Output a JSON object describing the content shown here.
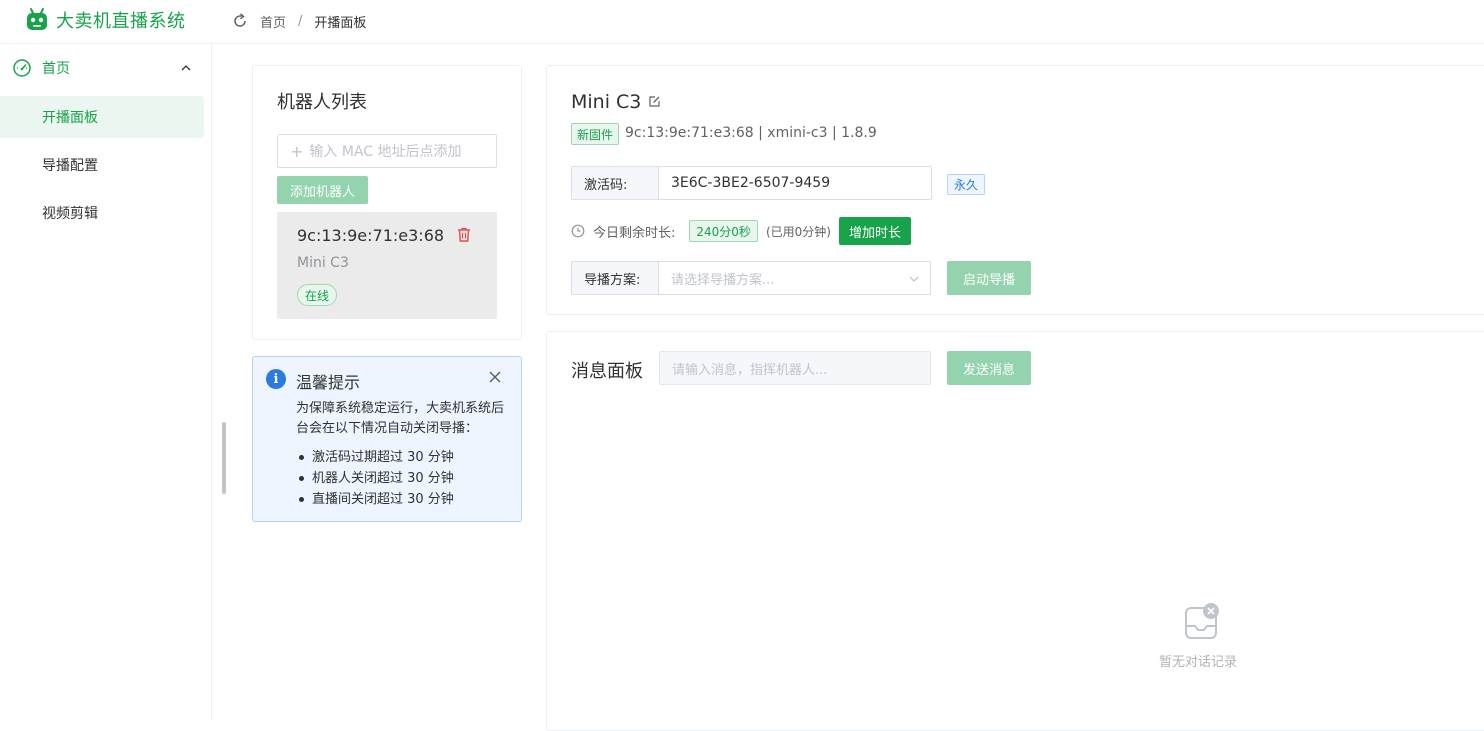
{
  "app": {
    "title": "大卖机直播系统",
    "accent": "#16a34a"
  },
  "breadcrumb": {
    "home": "首页",
    "separator": "/",
    "current": "开播面板"
  },
  "sidebar": {
    "group": "首页",
    "items": [
      {
        "label": "开播面板",
        "active": true
      },
      {
        "label": "导播配置",
        "active": false
      },
      {
        "label": "视频剪辑",
        "active": false
      }
    ]
  },
  "robots": {
    "title": "机器人列表",
    "input_placeholder": "输入 MAC 地址后点添加",
    "add_button": "添加机器人",
    "list": [
      {
        "mac": "9c:13:9e:71:e3:68",
        "model": "Mini C3",
        "status": "在线"
      }
    ]
  },
  "tip": {
    "title": "温馨提示",
    "body": "为保障系统稳定运行，大卖机系统后台会在以下情况自动关闭导播：",
    "items": [
      "激活码过期超过 30 分钟",
      "机器人关闭超过 30 分钟",
      "直播间关闭超过 30 分钟"
    ]
  },
  "device": {
    "name": "Mini C3",
    "firmware_tag": "新固件",
    "meta": "9c:13:9e:71:e3:68 | xmini-c3 | 1.8.9",
    "activation_label": "激活码:",
    "activation_code": "3E6C-3BE2-6507-9459",
    "activation_tag": "永久",
    "time_label": "今日剩余时长:",
    "time_remaining": "240分0秒",
    "time_used": "(已用0分钟)",
    "add_time_button": "增加时长",
    "plan_label": "导播方案:",
    "plan_placeholder": "请选择导播方案...",
    "start_button": "启动导播"
  },
  "messages": {
    "title": "消息面板",
    "input_placeholder": "请输入消息，指挥机器人...",
    "send_button": "发送消息",
    "empty_text": "暂无对话记录"
  }
}
